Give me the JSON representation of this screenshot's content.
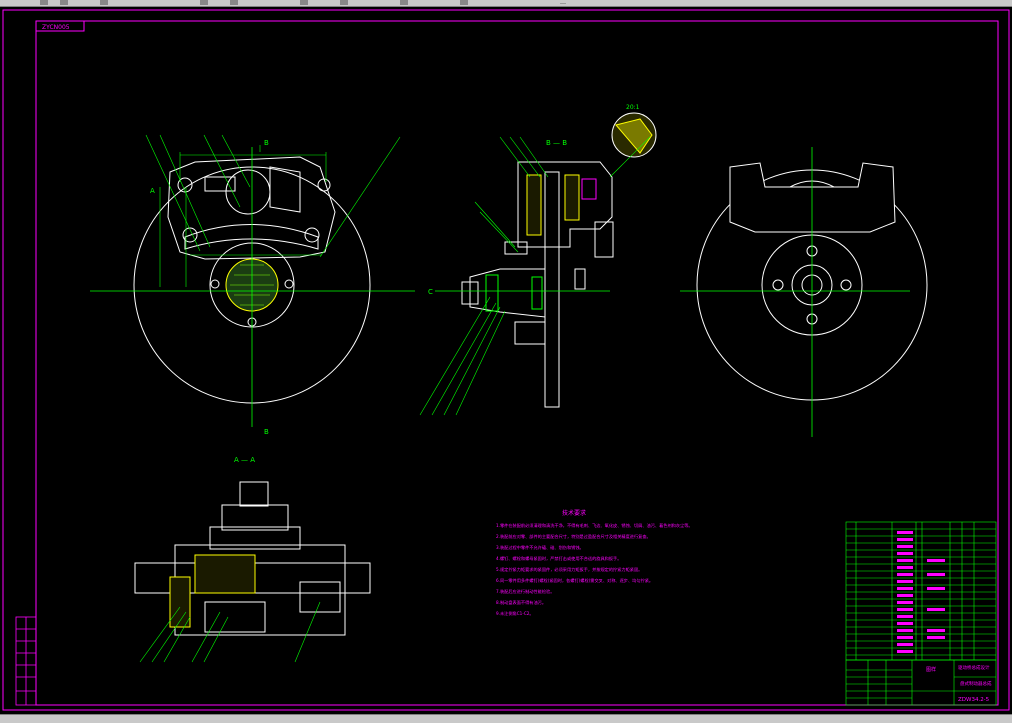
{
  "window": {
    "toolbar_label": "…"
  },
  "drawing": {
    "top_tag": "ZYCN005",
    "view_label_AA": "A — A",
    "view_label_BB": "B — B",
    "detail_label": "20:1",
    "label_A": "A",
    "label_B": "B",
    "label_C": "C",
    "tech_title": "技术要求",
    "tech_notes": [
      "1.零件在装配前必须清理和清洗干净，不得有毛刺、飞边、氧化皮、锈蚀、切屑、油污、着色剂和灰尘等。",
      "2.装配前应对零、部件的主要配合尺寸，特别是过盈配合尺寸及相关精度进行复查。",
      "3.装配过程中零件不允许磕、碰、划伤和锈蚀。",
      "4.螺钉、螺栓和螺母紧固时，严禁打击或使用不合适的旋具和扳手。",
      "5.规定拧紧力矩要求的紧固件，必须采用力矩扳手，并按规定的拧紧力矩紧固。",
      "6.同一零件用多件螺钉(螺栓)紧固时，各螺钉(螺栓)需交叉、对称、逐步、均匀拧紧。",
      "7.装配后应进行制动性能检验。",
      "8.制动盘表面不得有油污。",
      "9.未注倒角C1-C2。"
    ],
    "title_block": {
      "name_line1": "驱动桥总成设计",
      "name_line2": "盘式制动器总成",
      "drawing_no": "ZDW34.2-5",
      "school": "图样"
    }
  },
  "colors": {
    "background": "#000000",
    "frame": "#ff00ff",
    "outline": "#ffffff",
    "centerline": "#00ff00",
    "hatch": "#ffff00",
    "leader": "#00ff00"
  }
}
